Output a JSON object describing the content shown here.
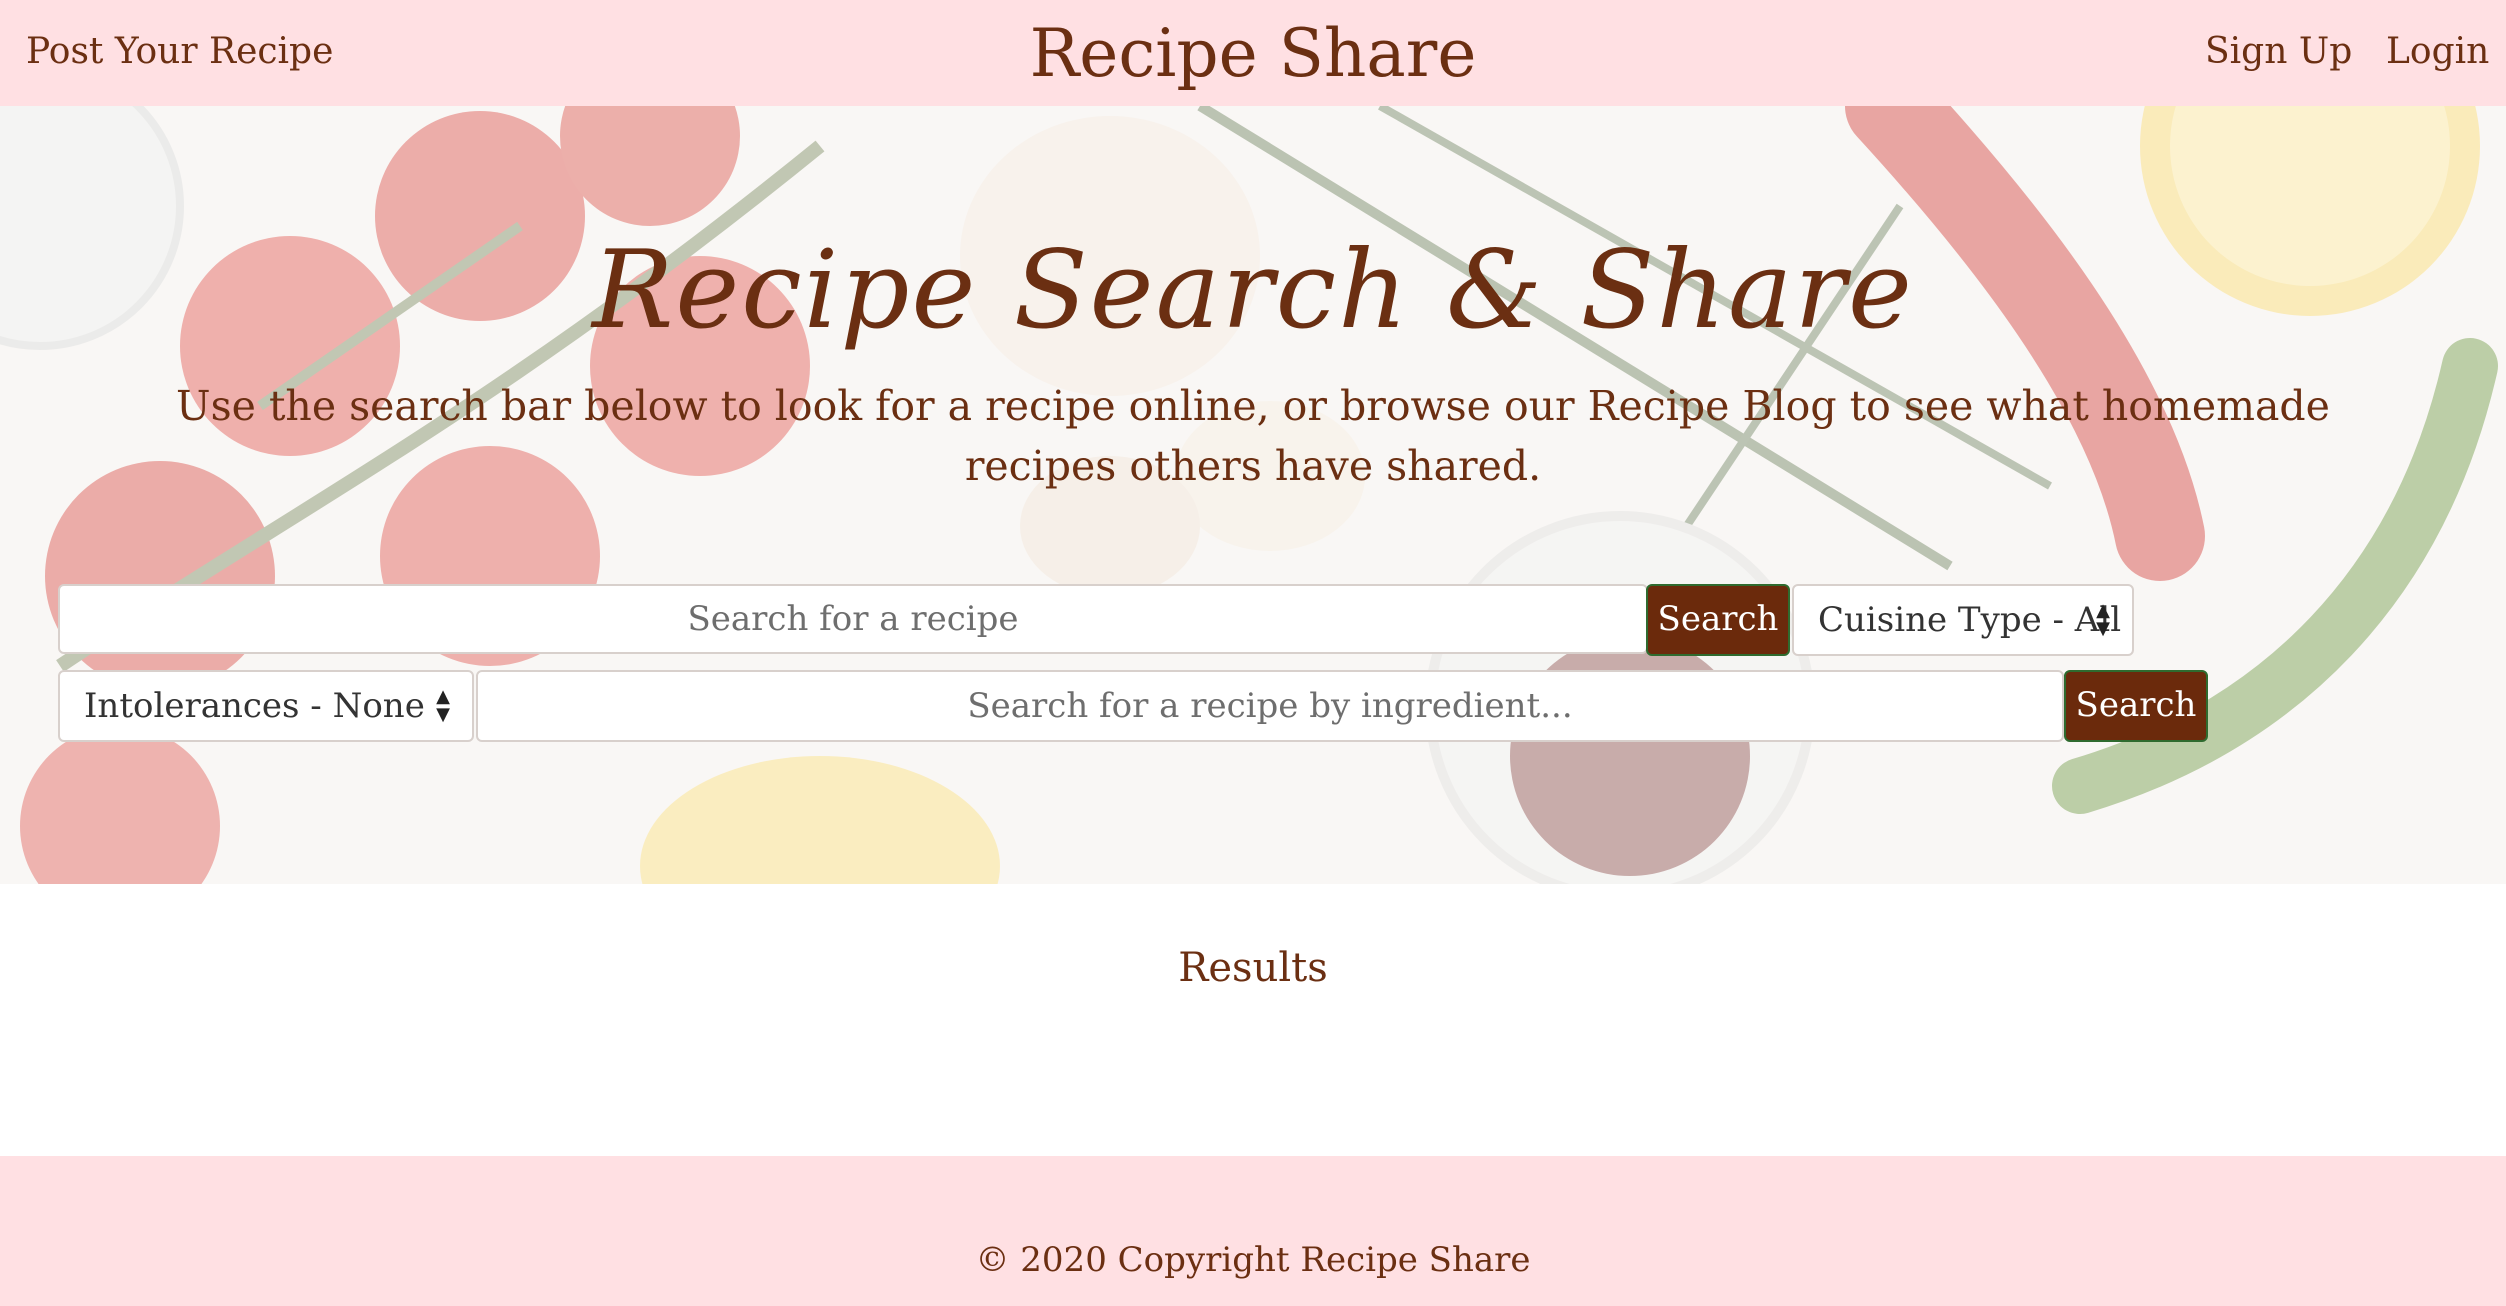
{
  "navbar": {
    "post_recipe": "Post Your Recipe",
    "brand": "Recipe Share",
    "sign_up": "Sign Up",
    "login": "Login"
  },
  "hero": {
    "title": "Recipe Search & Share",
    "subtitle": "Use the search bar below to look for a recipe online, or browse our Recipe Blog to see what homemade recipes others have shared."
  },
  "search": {
    "recipe_placeholder": "Search for a recipe",
    "recipe_button": "Search",
    "cuisine_select": "Cuisine Type - All",
    "intolerances_select": "Intolerances - None",
    "ingredient_placeholder": "Search for a recipe by ingredient...",
    "ingredient_button": "Search"
  },
  "results": {
    "title": "Results"
  },
  "footer": {
    "copyright": "© 2020 Copyright Recipe Share"
  },
  "colors": {
    "accent": "#6b2a0c",
    "nav_background": "#ffe0e3",
    "text": "#6b2f12"
  }
}
